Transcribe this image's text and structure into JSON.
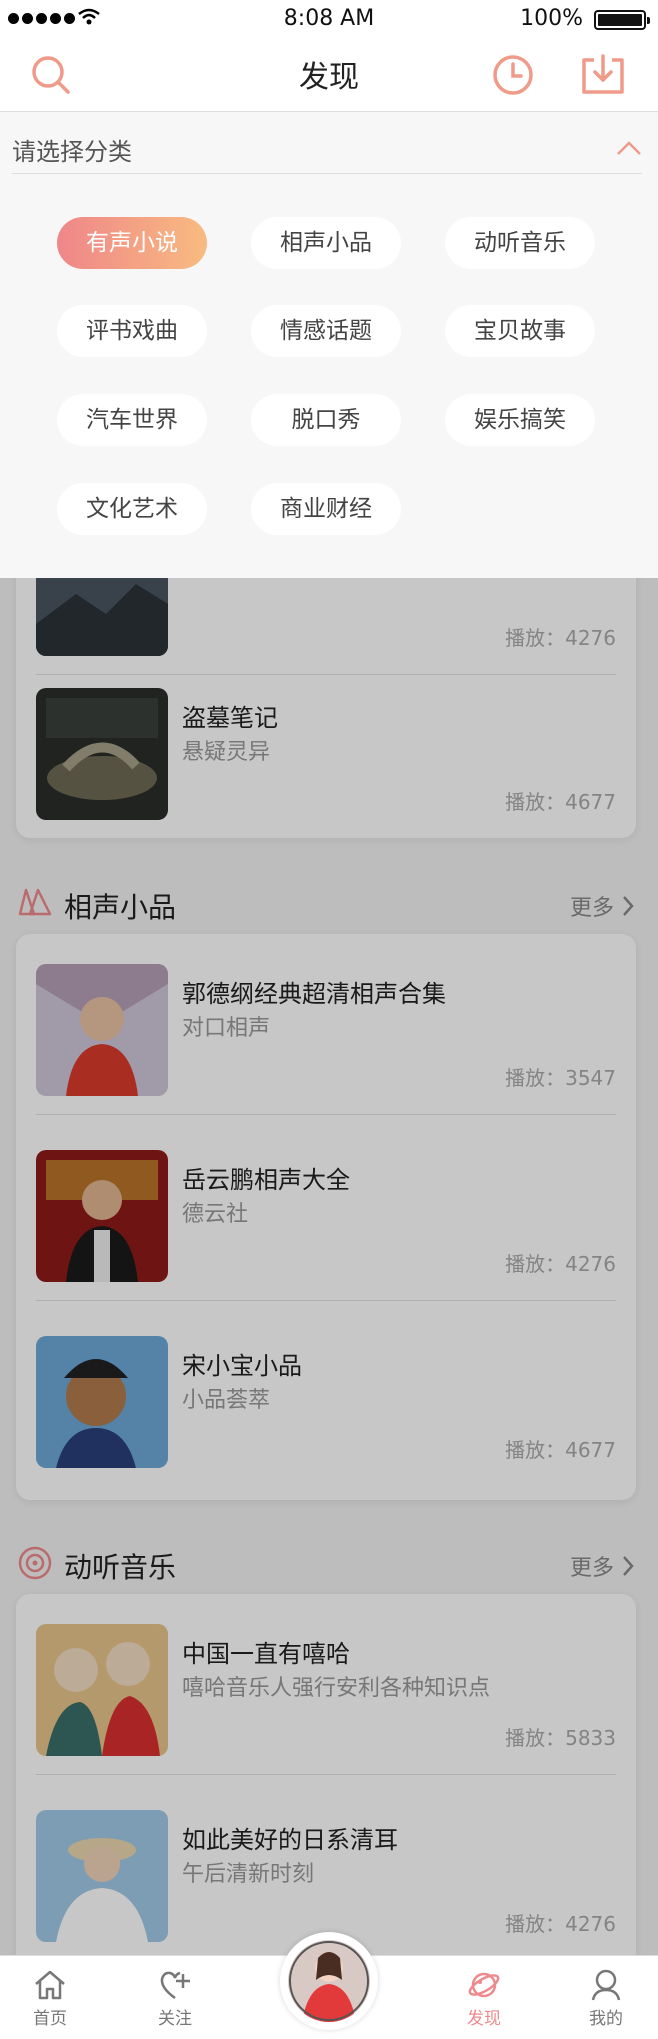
{
  "status_bar": {
    "time": "8:08 AM",
    "battery": "100%"
  },
  "nav": {
    "title": "发现",
    "search_icon": "search-icon",
    "history_icon": "clock-icon",
    "download_icon": "download-icon"
  },
  "category_panel": {
    "prompt": "请选择分类",
    "categories": [
      "有声小说",
      "相声小品",
      "动听音乐",
      "评书戏曲",
      "情感话题",
      "宝贝故事",
      "汽车世界",
      "脱口秀",
      "娱乐搞笑",
      "文化艺术",
      "商业财经"
    ],
    "selected": "有声小说"
  },
  "sections": {
    "novel": {
      "items": [
        {
          "plays": "播放：4276"
        },
        {
          "name": "盗墓笔记",
          "sub": "悬疑灵异",
          "plays": "播放：4677"
        }
      ]
    },
    "crosstalk": {
      "title": "相声小品",
      "more": "更多",
      "items": [
        {
          "name": "郭德纲经典超清相声合集",
          "sub": "对口相声",
          "plays": "播放：3547"
        },
        {
          "name": "岳云鹏相声大全",
          "sub": "德云社",
          "plays": "播放：4276"
        },
        {
          "name": "宋小宝小品",
          "sub": "小品荟萃",
          "plays": "播放：4677"
        }
      ]
    },
    "music": {
      "title": "动听音乐",
      "more": "更多",
      "items": [
        {
          "name": "中国一直有嘻哈",
          "sub": "嘻哈音乐人强行安利各种知识点",
          "plays": "播放：5833"
        },
        {
          "name": "如此美好的日系清耳",
          "sub": "午后清新时刻",
          "plays": "播放：4276"
        }
      ]
    }
  },
  "tab_bar": {
    "tabs": [
      {
        "label": "首页",
        "icon": "home-icon"
      },
      {
        "label": "关注",
        "icon": "heart-plus-icon"
      },
      {
        "label": "发现",
        "icon": "planet-icon"
      },
      {
        "label": "我的",
        "icon": "user-icon"
      }
    ],
    "active": "发现"
  },
  "colors": {
    "accent": "#ee8a8d",
    "accent_gradient_end": "#f8bb80"
  }
}
